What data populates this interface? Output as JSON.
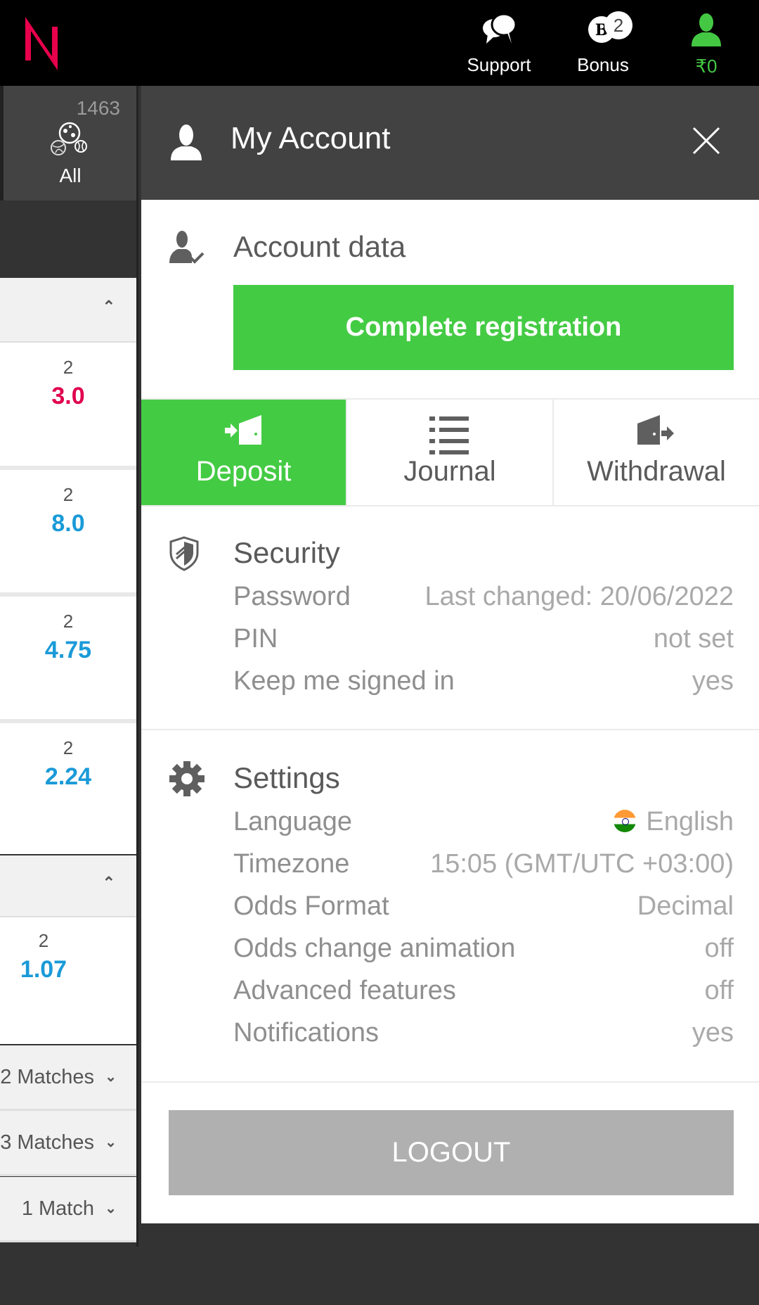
{
  "header": {
    "logo_letter": "N",
    "support_label": "Support",
    "bonus_label": "Bonus",
    "bonus_badge": "2",
    "balance": "₹0"
  },
  "sports": {
    "tab_count": "1463",
    "tab_label": "All"
  },
  "events": {
    "odds": [
      {
        "outcome": "2",
        "value": "3.0",
        "color": "#e0004d"
      },
      {
        "outcome": "2",
        "value": "8.0",
        "color": "#1a9ad8"
      },
      {
        "outcome": "2",
        "value": "4.75",
        "color": "#1a9ad8"
      },
      {
        "outcome": "2",
        "value": "2.24",
        "color": "#1a9ad8"
      },
      {
        "outcome": "2",
        "value": "1.07",
        "color": "#1a9ad8"
      }
    ],
    "match_groups": [
      "2 Matches",
      "3 Matches",
      "1 Match"
    ]
  },
  "account": {
    "title": "My Account",
    "account_data_title": "Account data",
    "complete_registration": "Complete registration",
    "tabs": [
      {
        "label": "Deposit",
        "active": true
      },
      {
        "label": "Journal",
        "active": false
      },
      {
        "label": "Withdrawal",
        "active": false
      }
    ],
    "security": {
      "title": "Security",
      "rows": [
        {
          "label": "Password",
          "value": "Last changed: 20/06/2022"
        },
        {
          "label": "PIN",
          "value": "not set"
        },
        {
          "label": "Keep me signed in",
          "value": "yes"
        }
      ]
    },
    "settings": {
      "title": "Settings",
      "rows": [
        {
          "label": "Language",
          "value": "English"
        },
        {
          "label": "Timezone",
          "value": "15:05 (GMT/UTC +03:00)"
        },
        {
          "label": "Odds Format",
          "value": "Decimal"
        },
        {
          "label": "Odds change animation",
          "value": "off"
        },
        {
          "label": "Advanced features",
          "value": "off"
        },
        {
          "label": "Notifications",
          "value": "yes"
        }
      ]
    },
    "logout_label": "LOGOUT"
  },
  "colors": {
    "accent_green": "#44cb44",
    "brand_red": "#e8004c",
    "odds_blue": "#1a9ad8"
  }
}
